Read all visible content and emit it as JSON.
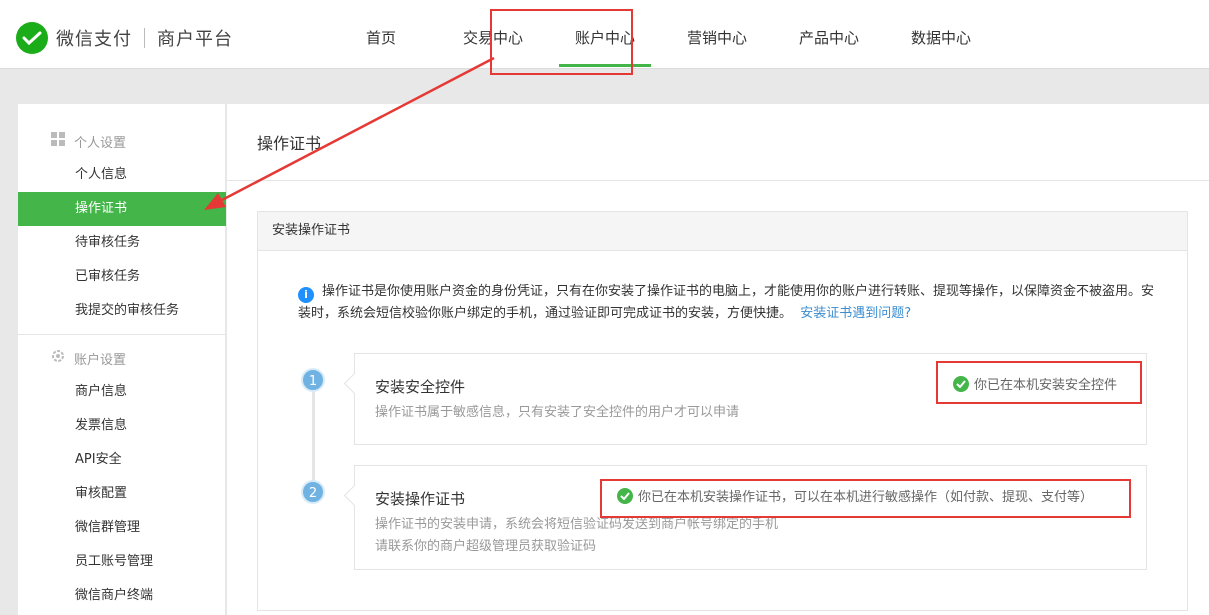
{
  "brand": {
    "name": "微信支付",
    "subtitle": "商户平台",
    "accent_color": "#44b549",
    "logo_icon": "wechat-pay-logo-icon"
  },
  "nav": {
    "items": [
      {
        "label": "首页",
        "active": false
      },
      {
        "label": "交易中心",
        "active": false
      },
      {
        "label": "账户中心",
        "active": true
      },
      {
        "label": "营销中心",
        "active": false
      },
      {
        "label": "产品中心",
        "active": false
      },
      {
        "label": "数据中心",
        "active": false
      }
    ]
  },
  "sidebar": {
    "groups": [
      {
        "title": "个人设置",
        "icon": "grid-icon",
        "items": [
          {
            "label": "个人信息",
            "active": false
          },
          {
            "label": "操作证书",
            "active": true
          },
          {
            "label": "待审核任务",
            "active": false
          },
          {
            "label": "已审核任务",
            "active": false
          },
          {
            "label": "我提交的审核任务",
            "active": false
          }
        ]
      },
      {
        "title": "账户设置",
        "icon": "gear-icon",
        "items": [
          {
            "label": "商户信息",
            "active": false
          },
          {
            "label": "发票信息",
            "active": false
          },
          {
            "label": "API安全",
            "active": false
          },
          {
            "label": "审核配置",
            "active": false
          },
          {
            "label": "微信群管理",
            "active": false
          },
          {
            "label": "员工账号管理",
            "active": false
          },
          {
            "label": "微信商户终端",
            "active": false
          }
        ]
      }
    ]
  },
  "main": {
    "title": "操作证书",
    "panel": {
      "title": "安装操作证书",
      "notice_icon": "info-icon",
      "notice_text": "操作证书是你使用账户资金的身份凭证，只有在你安装了操作证书的电脑上，才能使用你的账户进行转账、提现等操作，以保障资金不被盗用。安装时，系统会短信校验你账户绑定的手机，通过验证即可完成证书的安装，方便快捷。",
      "notice_link": "安装证书遇到问题?",
      "steps": [
        {
          "number": "1",
          "title": "安装安全控件",
          "desc_lines": [
            "操作证书属于敏感信息，只有安装了安全控件的用户才可以申请"
          ],
          "status": "你已在本机安装安全控件"
        },
        {
          "number": "2",
          "title": "安装操作证书",
          "desc_lines": [
            "操作证书的安装申请，系统会将短信验证码发送到商户帐号绑定的手机",
            "请联系你的商户超级管理员获取验证码"
          ],
          "status": "你已在本机安装操作证书，可以在本机进行敏感操作（如付款、提现、支付等）"
        }
      ]
    }
  },
  "annotation_color": "#e53935"
}
